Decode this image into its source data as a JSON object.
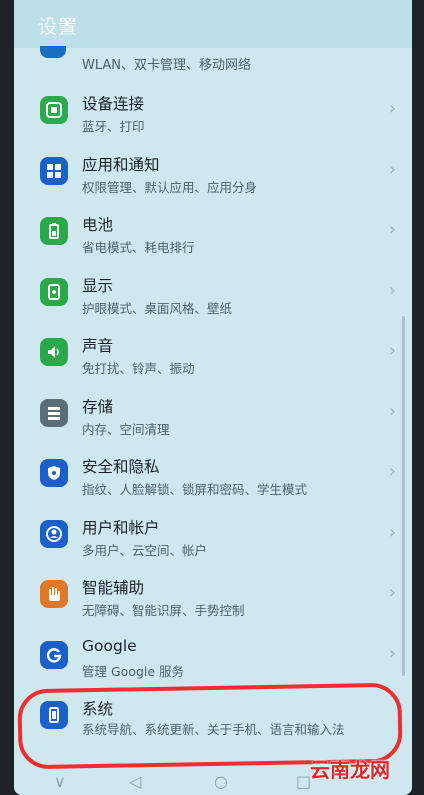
{
  "header": {
    "title": "设置"
  },
  "top_partial": {
    "sub": "WLAN、双卡管理、移动网络",
    "icon_color": "#1b6fc2"
  },
  "items": [
    {
      "label": "设备连接",
      "sub": "蓝牙、打印",
      "icon": "device-connect-icon",
      "color": "#2fa84f"
    },
    {
      "label": "应用和通知",
      "sub": "权限管理、默认应用、应用分身",
      "icon": "apps-icon",
      "color": "#1b5fc8"
    },
    {
      "label": "电池",
      "sub": "省电模式、耗电排行",
      "icon": "battery-icon",
      "color": "#2aa84a"
    },
    {
      "label": "显示",
      "sub": "护眼模式、桌面风格、壁纸",
      "icon": "display-icon",
      "color": "#2aa84a"
    },
    {
      "label": "声音",
      "sub": "免打扰、铃声、振动",
      "icon": "sound-icon",
      "color": "#2aa84a"
    },
    {
      "label": "存储",
      "sub": "内存、空间清理",
      "icon": "storage-icon",
      "color": "#5b6e78"
    },
    {
      "label": "安全和隐私",
      "sub": "指纹、人脸解锁、锁屏和密码、学生模式",
      "icon": "shield-icon",
      "color": "#1b5fc8"
    },
    {
      "label": "用户和帐户",
      "sub": "多用户、云空间、帐户",
      "icon": "user-icon",
      "color": "#1b5fc8"
    },
    {
      "label": "智能辅助",
      "sub": "无障碍、智能识屏、手势控制",
      "icon": "hand-icon",
      "color": "#e0782a"
    },
    {
      "label": "Google",
      "sub": "管理 Google 服务",
      "icon": "google-icon",
      "color": "#1b5fc8"
    },
    {
      "label": "系统",
      "sub": "系统导航、系统更新、关于手机、语言和输入法",
      "icon": "phone-icon",
      "color": "#1b5fc8"
    }
  ],
  "chevron": "›",
  "nav": {
    "back": "◁",
    "home": "○",
    "recents": "□",
    "down": "∨"
  },
  "watermark": "云南龙网",
  "annotation_color": "#ee2e33"
}
